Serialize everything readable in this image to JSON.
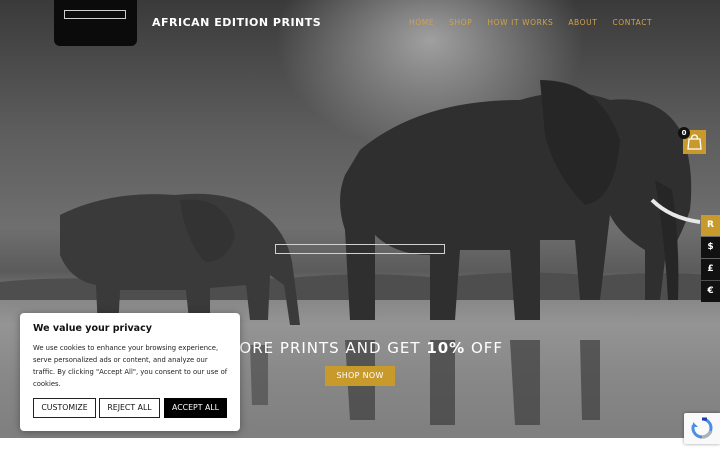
{
  "brand": {
    "name": "AFRICAN EDITION PRINTS"
  },
  "nav": {
    "items": [
      "HOME",
      "SHOP",
      "HOW IT WORKS",
      "ABOUT",
      "CONTACT"
    ]
  },
  "cart": {
    "count": "0"
  },
  "currencies": [
    "R",
    "$",
    "£",
    "€"
  ],
  "hero": {
    "promo_prefix": "O OR MORE PRINTS AND GET ",
    "promo_highlight": "10%",
    "promo_suffix": " OFF",
    "cta": "SHOP NOW"
  },
  "cookie": {
    "title": "We value your privacy",
    "body": "We use cookies to enhance your browsing experience, serve personalized ads or content, and analyze our traffic. By clicking \"Accept All\", you consent to our use of cookies.",
    "customize": "CUSTOMIZE",
    "reject": "REJECT ALL",
    "accept": "ACCEPT ALL"
  },
  "colors": {
    "accent": "#c89a2c",
    "nav_text": "#d2a24a",
    "logo_bg": "#0b0b0b"
  },
  "icons": [
    "cart-icon",
    "recaptcha-icon"
  ]
}
